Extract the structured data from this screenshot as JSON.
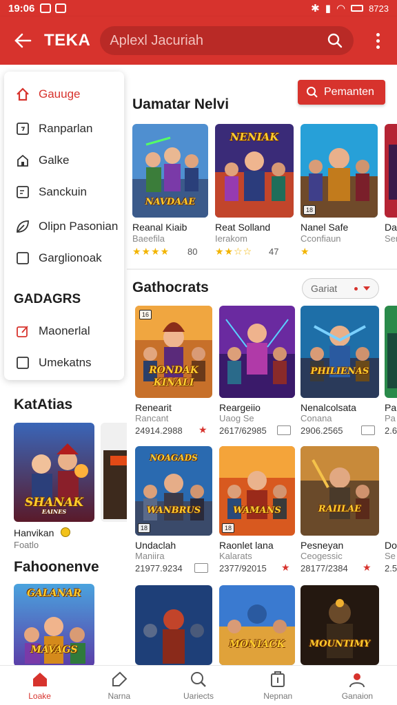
{
  "status_bar": {
    "time": "19:06",
    "battery": "8723"
  },
  "app_bar": {
    "title": "TEKA",
    "search_placeholder": "Aplexl Jacuriah"
  },
  "side_menu": {
    "items": [
      {
        "label": "Gauuge",
        "icon": "home-icon",
        "active": true
      },
      {
        "label": "Ranparlan",
        "icon": "calendar-icon"
      },
      {
        "label": "Galke",
        "icon": "house-icon"
      },
      {
        "label": "Sanckuin",
        "icon": "note-icon"
      },
      {
        "label": "Olipn Pasonian",
        "icon": "leaf-icon"
      },
      {
        "label": "Garglionoak",
        "icon": "square-icon"
      }
    ],
    "section_title": "GADAGRS",
    "section_items": [
      {
        "label": "Maonerlal",
        "icon": "edit-icon"
      },
      {
        "label": "Umekatns",
        "icon": "square-icon"
      }
    ]
  },
  "left_panel": {
    "katatias": {
      "heading": "KatAtias",
      "card_title": "Hanvikan",
      "card_sub": "Foatlo",
      "cover_text": "SHANAK",
      "cover_sub": "EAINES"
    },
    "fahoonenve": {
      "heading": "Fahoonenve",
      "cover_top": "GALANAR",
      "cover_text": "MAVAGS"
    }
  },
  "main": {
    "promo_button": "Pemanten",
    "section1": {
      "title": "Uamatar Nelvi",
      "games": [
        {
          "title": "Reanal Kiaib",
          "sub": "Baeefila",
          "stars": "★★★★",
          "rating": "80",
          "cover_text": "NAVDAAE"
        },
        {
          "title": "Reat Solland",
          "sub": "Ierakom",
          "stars": "★★☆☆",
          "rating": "47",
          "cover_text": "NENIAK"
        },
        {
          "title": "Nanel Safe",
          "sub": "Cconfiaun",
          "stars": "★",
          "rating": "",
          "cover_text": ""
        },
        {
          "title": "Da",
          "sub": "Ser",
          "stars": "",
          "rating": "",
          "cover_text": ""
        }
      ]
    },
    "section2": {
      "title": "Gathocrats",
      "filter": "Gariat",
      "games_row1": [
        {
          "title": "Renearit",
          "sub": "Rancant",
          "meta": "24914.2988",
          "cover_text": "KINALI",
          "cover_top": "RONDAK"
        },
        {
          "title": "Reargeiio",
          "sub": "Uaog Se",
          "meta": "2617/62985",
          "cover_text": "",
          "cover_top": ""
        },
        {
          "title": "Nenalcolsata",
          "sub": "Conana",
          "meta": "2906.2565",
          "cover_text": "PHILIENAS",
          "cover_top": ""
        },
        {
          "title": "Pa",
          "sub": "Pa",
          "meta": "2.6",
          "cover_text": "",
          "cover_top": ""
        }
      ],
      "games_row2": [
        {
          "title": "Undaclah",
          "sub": "Maniira",
          "meta": "21977.9234",
          "cover_text": "WANBRUS",
          "cover_top": "NOAGADS"
        },
        {
          "title": "Raonlet lana",
          "sub": "Kalarats",
          "meta": "2377/92015",
          "cover_text": "WAMANS",
          "cover_top": ""
        },
        {
          "title": "Pesneyan",
          "sub": "Ceogessic",
          "meta": "28177/2384",
          "cover_text": "RAIILAE",
          "cover_top": ""
        },
        {
          "title": "Do",
          "sub": "Se",
          "meta": "2.5",
          "cover_text": "",
          "cover_top": ""
        }
      ],
      "games_row3": [
        {
          "cover_text": ""
        },
        {
          "cover_text": "MONIACK"
        },
        {
          "cover_text": "MOUNTIMY"
        }
      ]
    }
  },
  "bottom_nav": [
    {
      "label": "Loake",
      "icon": "home-icon",
      "active": true
    },
    {
      "label": "Narna",
      "icon": "tag-icon"
    },
    {
      "label": "Uariects",
      "icon": "search-icon"
    },
    {
      "label": "Nepnan",
      "icon": "clipboard-icon"
    },
    {
      "label": "Ganaion",
      "icon": "profile-icon"
    }
  ],
  "colors": {
    "accent": "#d7332d",
    "accent_dark": "#b92a26",
    "star": "#f2b400"
  }
}
